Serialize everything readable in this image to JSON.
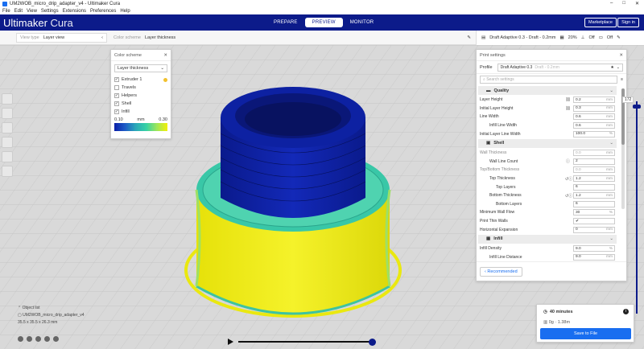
{
  "window": {
    "title": "UM2WOB_micro_drip_adapter_v4 - Ultimaker Cura",
    "controls": [
      "–",
      "□",
      "✕"
    ]
  },
  "menu": [
    "File",
    "Edit",
    "View",
    "Settings",
    "Extensions",
    "Preferences",
    "Help"
  ],
  "header": {
    "logo_main": "Ultimaker",
    "logo_sub": "Cura",
    "tabs": [
      {
        "label": "PREPARE"
      },
      {
        "label": "PREVIEW",
        "active": true
      },
      {
        "label": "MONITOR"
      }
    ],
    "marketplace": "Marketplace",
    "signin": "Sign in"
  },
  "toolbar": {
    "view_type_label": "View type",
    "view_type_value": "Layer view",
    "color_scheme_label": "Color scheme",
    "color_scheme_value": "Layer thickness",
    "print_profile": "Draft Adaptive 0.3 - Draft - 0.2mm",
    "infill": "20%",
    "support": "Off",
    "adhesion": "Off"
  },
  "color_panel": {
    "title": "Color scheme",
    "selected": "Layer thickness",
    "items": [
      {
        "label": "Extruder 1",
        "checked": true
      },
      {
        "label": "Travels",
        "checked": false
      },
      {
        "label": "Helpers",
        "checked": true
      },
      {
        "label": "Shell",
        "checked": true
      },
      {
        "label": "Infill",
        "checked": true
      }
    ],
    "range_min": "0.10",
    "range_unit": "mm",
    "range_max": "0.30"
  },
  "print_settings": {
    "title": "Print settings",
    "profile_label": "Profile",
    "profile_value": "Draft Adaptive 0.3",
    "profile_hint": "Draft - 0.2mm",
    "search_placeholder": "Search settings",
    "rows": [
      {
        "type": "cat",
        "label": "Quality",
        "icon": "quality-icon"
      },
      {
        "type": "row",
        "label": "Layer Height",
        "value": "0.2",
        "unit": "mm",
        "ind": 0,
        "icon": "link-icon"
      },
      {
        "type": "row",
        "label": "Initial Layer Height",
        "value": "0.3",
        "unit": "mm",
        "ind": 0,
        "icon": "link-icon"
      },
      {
        "type": "row",
        "label": "Line Width",
        "value": "0.6",
        "unit": "mm",
        "ind": 0
      },
      {
        "type": "row",
        "label": "Infill Line Width",
        "value": "0.6",
        "unit": "mm",
        "ind": 1
      },
      {
        "type": "row",
        "label": "Initial Layer Line Width",
        "value": "100.0",
        "unit": "%",
        "ind": 0
      },
      {
        "type": "cat",
        "label": "Shell",
        "icon": "shell-icon"
      },
      {
        "type": "row",
        "label": "Wall Thickness",
        "value": "0.0",
        "unit": "mm",
        "ind": 0,
        "dim": true
      },
      {
        "type": "row",
        "label": "Wall Line Count",
        "value": "2",
        "unit": "",
        "ind": 1,
        "icon": "info-icon"
      },
      {
        "type": "row",
        "label": "Top/Bottom Thickness",
        "value": "0.0",
        "unit": "mm",
        "ind": 0,
        "dim": true
      },
      {
        "type": "row",
        "label": "Top Thickness",
        "value": "1.2",
        "unit": "mm",
        "ind": 1,
        "icon": "reset-info-icon"
      },
      {
        "type": "row",
        "label": "Top Layers",
        "value": "6",
        "unit": "",
        "ind": 2
      },
      {
        "type": "row",
        "label": "Bottom Thickness",
        "value": "1.2",
        "unit": "mm",
        "ind": 1,
        "icon": "reset-info-icon"
      },
      {
        "type": "row",
        "label": "Bottom Layers",
        "value": "6",
        "unit": "",
        "ind": 2
      },
      {
        "type": "row",
        "label": "Minimum Wall Flow",
        "value": "30",
        "unit": "%",
        "ind": 0
      },
      {
        "type": "row",
        "label": "Print Thin Walls",
        "value": "✔",
        "unit": "",
        "ind": 0,
        "check": true
      },
      {
        "type": "row",
        "label": "Horizontal Expansion",
        "value": "0",
        "unit": "mm",
        "ind": 0
      },
      {
        "type": "cat",
        "label": "Infill",
        "icon": "infill-icon"
      },
      {
        "type": "row",
        "label": "Infill Density",
        "value": "9.0",
        "unit": "%",
        "ind": 0
      },
      {
        "type": "row",
        "label": "Infill Line Distance",
        "value": "9.0",
        "unit": "mm",
        "ind": 1
      }
    ],
    "recommended_label": "Recommended"
  },
  "layer_slider_value": "172",
  "objects": {
    "label": "Object list",
    "name": "UM2WOB_micro_drip_adapter_v4",
    "dims": "35.5 x 35.5 x 26.3 mm"
  },
  "estimate": {
    "time": "40 minutes",
    "material": "0g · 1.38m",
    "save_label": "Save to File"
  },
  "colors": {
    "accent": "#196ef0",
    "header": "#0c1b8a",
    "model_top": "#0b1fa8",
    "model_base": "#f2f00a"
  }
}
